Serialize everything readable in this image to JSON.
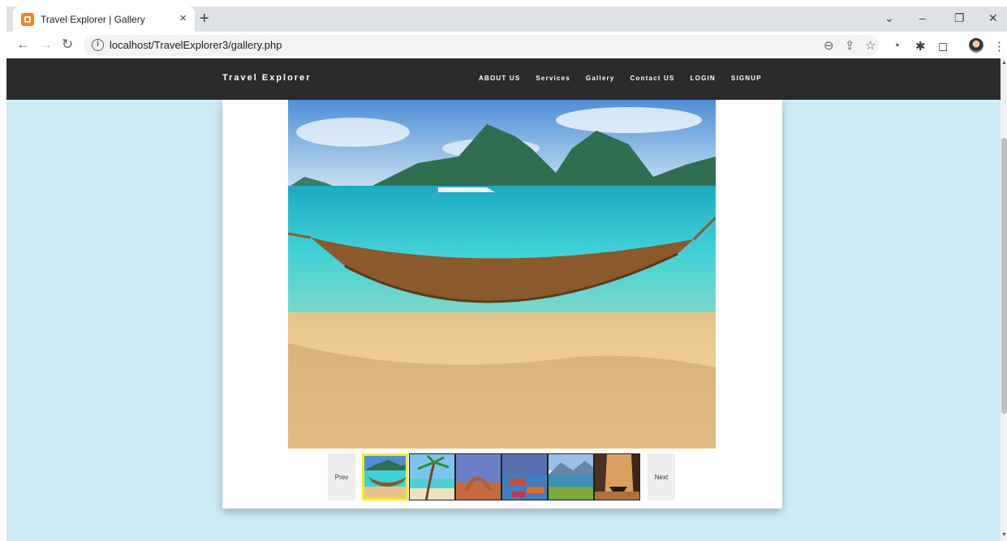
{
  "browser": {
    "tab_title": "Travel Explorer | Gallery",
    "tab_close": "×",
    "new_tab": "+",
    "url": "localhost/TravelExplorer3/gallery.php",
    "window_controls": {
      "dropdown": "⌄",
      "minimize": "–",
      "restore": "❐",
      "close": "✕"
    }
  },
  "site": {
    "brand": "Travel Explorer",
    "menu": [
      "ABOUT US",
      "Services",
      "Gallery",
      "Contact US",
      "LOGIN",
      "SIGNUP"
    ]
  },
  "gallery": {
    "prev_label": "Prev",
    "next_label": "Next",
    "thumbnails": [
      "hammock-beach",
      "palm-beach",
      "arch-rock",
      "boats-harbor",
      "mountain-lake",
      "boat-cliffs"
    ],
    "active_index": 0
  },
  "colors": {
    "page_bg": "#cdebf5",
    "navbar_bg": "#2b2b2b",
    "active_thumb_border": "#f5ec2a"
  }
}
